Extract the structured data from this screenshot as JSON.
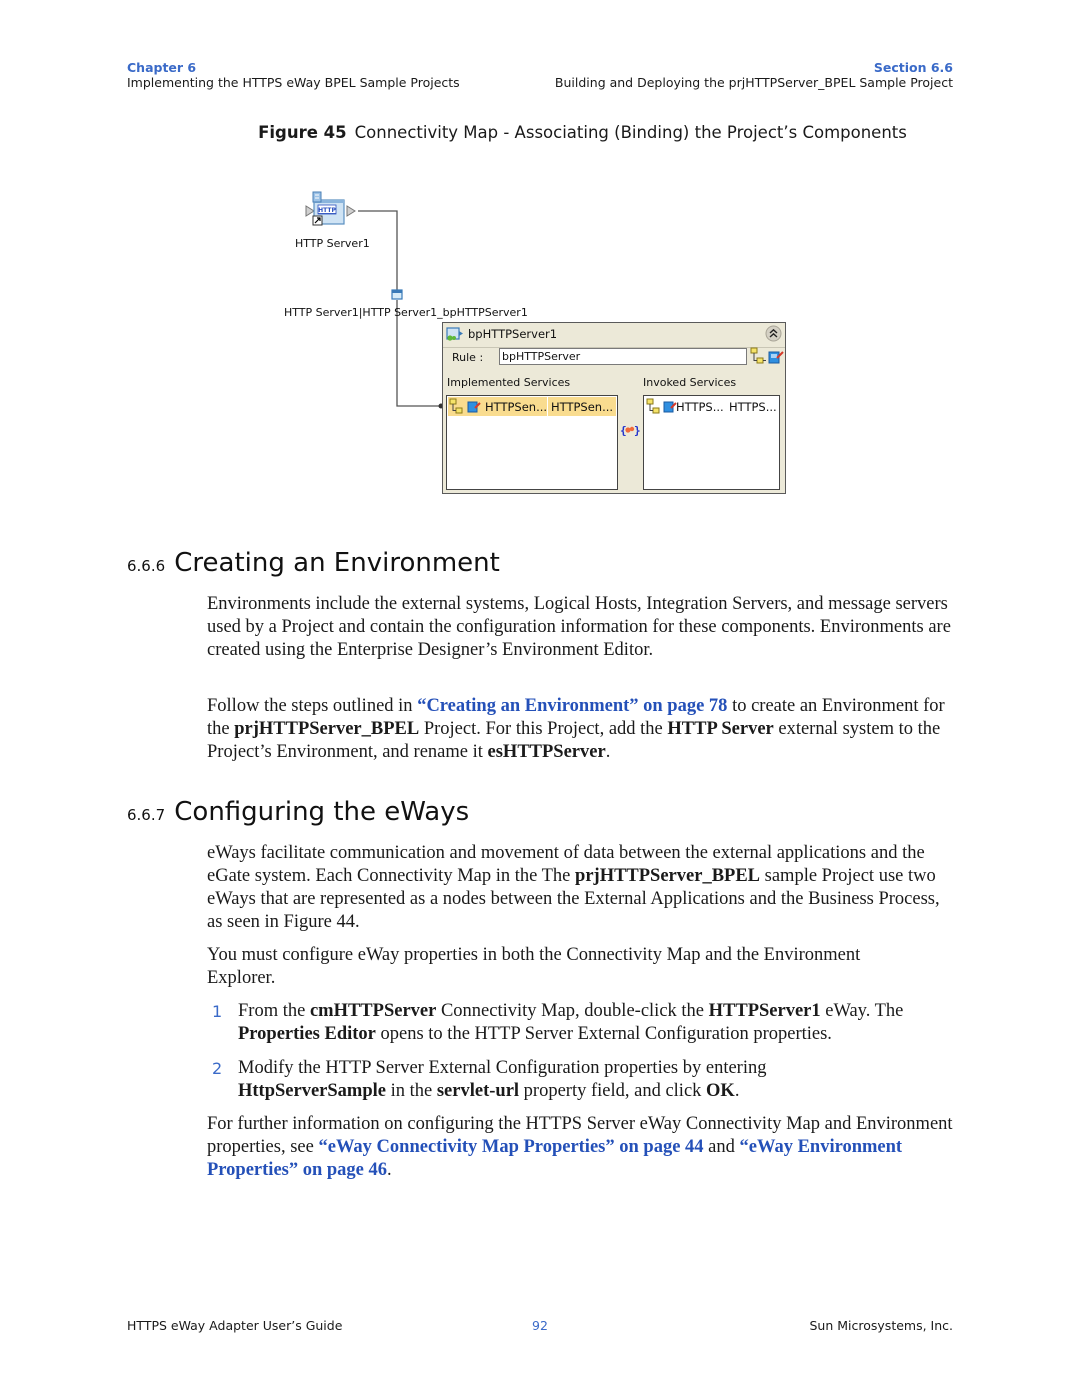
{
  "header": {
    "chapter_label": "Chapter 6",
    "chapter_title": "Implementing the HTTPS eWay BPEL Sample Projects",
    "section_label": "Section 6.6",
    "section_title": "Building and Deploying the prjHTTPServer_BPEL Sample Project"
  },
  "figure": {
    "number": "Figure 45",
    "caption": "Connectivity Map - Associating (Binding) the Project’s Components",
    "eway_icon_label": "HTTP",
    "eway_name": "HTTP Server1",
    "link_label": "HTTP Server1|HTTP Server1_bpHTTPServer1",
    "bp_panel": {
      "title": "bpHTTPServer1",
      "rule_label": "Rule :",
      "rule_value": "bpHTTPServer",
      "implemented_header": "Implemented Services",
      "invoked_header": "Invoked Services",
      "implemented_items": [
        {
          "col1": "HTTPSen...",
          "col2": "HTTPSen...",
          "selected": true
        }
      ],
      "invoked_items": [
        {
          "col1": "HTTPS...",
          "col2": "HTTPS..."
        }
      ]
    }
  },
  "section_666": {
    "number": "6.6.6",
    "title": "Creating an Environment",
    "p1": "Environments include the external systems, Logical Hosts, Integration Servers, and message servers used by a Project and contain the configuration information for these components. Environments are created using the Enterprise Designer’s Environment Editor.",
    "p2_a": "Follow the steps outlined in ",
    "p2_link": "“Creating an Environment” on page 78",
    "p2_b": " to create an Environment for the ",
    "p2_bold1": "prjHTTPServer_BPEL",
    "p2_c": " Project. For this Project, add the ",
    "p2_bold2": "HTTP Server",
    "p2_d": " external system to the Project’s Environment, and rename it ",
    "p2_bold3": "esHTTPServer",
    "p2_e": "."
  },
  "section_667": {
    "number": "6.6.7",
    "title": "Configuring the eWays",
    "p1_a": "eWays facilitate communication and movement of data between the external applications and the eGate system. Each Connectivity Map in the The ",
    "p1_bold": "prjHTTPServer_BPEL",
    "p1_b": " sample Project use two eWays that are represented as a nodes between the External Applications and the Business Process, as seen in Figure 44.",
    "p2": "You must configure eWay properties in both the Connectivity Map and the Environment Explorer.",
    "steps": [
      {
        "n": "1",
        "a": "From the ",
        "b1": "cmHTTPServer",
        "c": " Connectivity Map, double-click the ",
        "b2": "HTTPServer1",
        "d": " eWay. The ",
        "b3": "Properties Editor",
        "e": " opens to the HTTP Server External Configuration properties."
      },
      {
        "n": "2",
        "a": "Modify the HTTP Server External Configuration properties by entering ",
        "b1": "HttpServerSample",
        "c": " in the ",
        "b2": "servlet-url",
        "d": " property field, and click ",
        "b3": "OK",
        "e": "."
      }
    ],
    "p3_a": "For further information on configuring the HTTPS Server eWay Connectivity Map and Environment properties, see ",
    "p3_link1": "“eWay Connectivity Map Properties” on page 44",
    "p3_b": " and ",
    "p3_link2": "“eWay Environment Properties” on page 46",
    "p3_c": "."
  },
  "footer": {
    "left": "HTTPS eWay Adapter User’s Guide",
    "page": "92",
    "right": "Sun Microsystems, Inc."
  }
}
